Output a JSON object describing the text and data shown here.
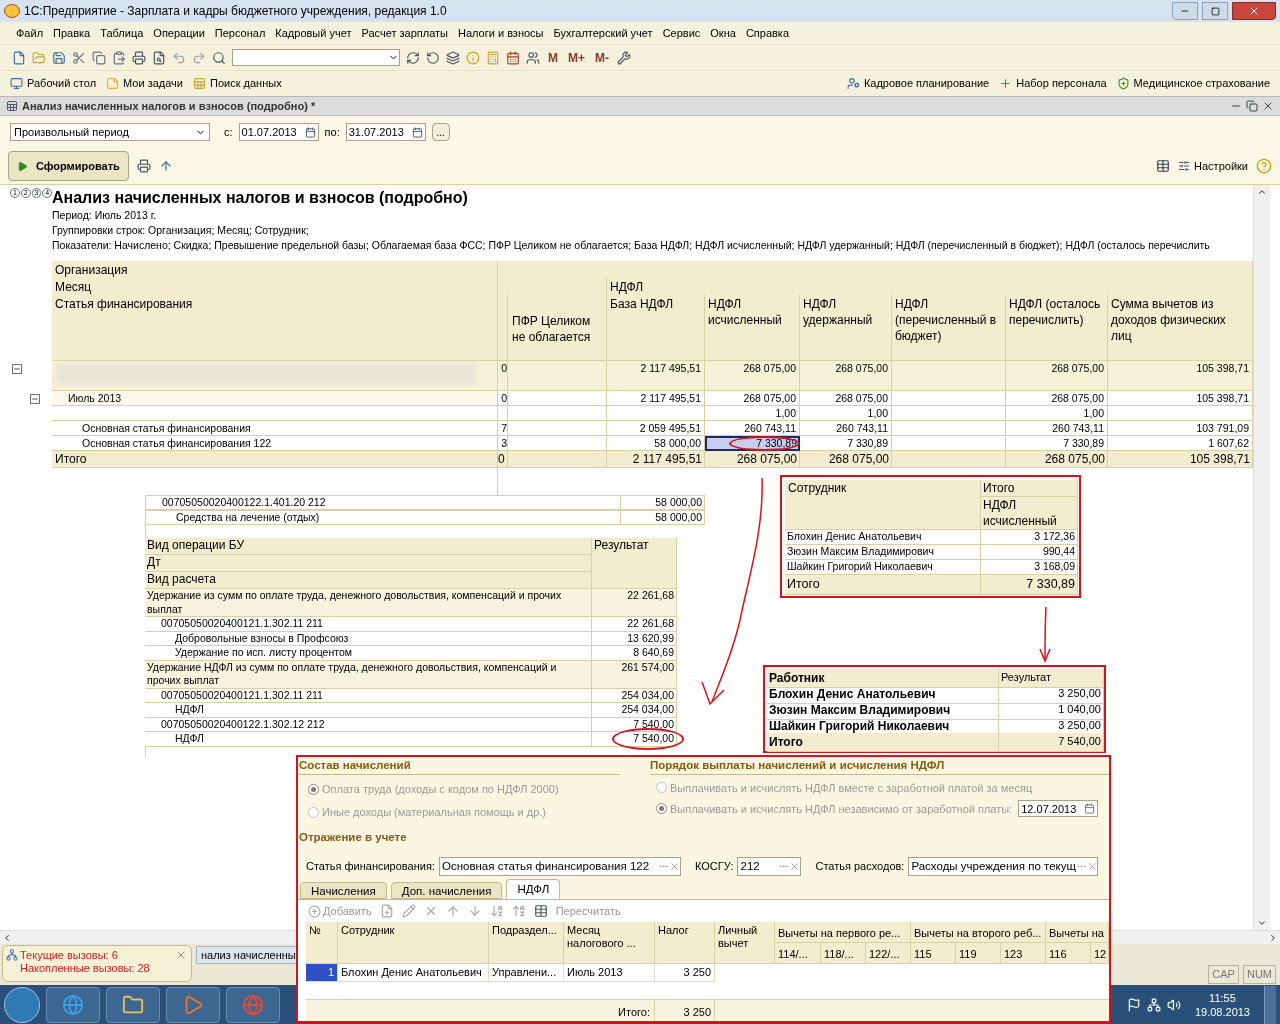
{
  "window": {
    "title": "1С:Предприятие - Зарплата и кадры бюджетного учреждения, редакция 1.0"
  },
  "menu": [
    "Файл",
    "Правка",
    "Таблица",
    "Операции",
    "Персонал",
    "Кадровый учет",
    "Расчет зарплаты",
    "Налоги и взносы",
    "Бухгалтерский учет",
    "Сервис",
    "Окна",
    "Справка"
  ],
  "memory_buttons": [
    "M",
    "M+",
    "M-"
  ],
  "panel_left": [
    "Рабочий стол",
    "Мои задачи",
    "Поиск данных"
  ],
  "panel_right": [
    "Кадровое планирование",
    "Набор персонала",
    "Медицинское страхование"
  ],
  "document": {
    "title": "Анализ начисленных налогов и взносов (подробно) *"
  },
  "period": {
    "type": "Произвольный период",
    "from_label": "с:",
    "from": "01.07.2013",
    "to_label": "по:",
    "to": "31.07.2013",
    "more": "..."
  },
  "generate_button": "Сформировать",
  "settings_button": "Настройки",
  "group_levels": [
    "1",
    "2",
    "3",
    "4"
  ],
  "report": {
    "title": "Анализ начисленных налогов и взносов (подробно)",
    "lines": [
      "Период: Июль 2013 г.",
      "Группировки строк: Организация; Месяц; Сотрудник;",
      "Показатели: Начислено; Скидка; Превышение предельной базы; Облагаемая база ФСС; ПФР Целиком не облагается; База НДФЛ; НДФЛ исчисленный; НДФЛ удержанный; НДФЛ (перечисленный в бюджет); НДФЛ (осталось перечислить"
    ],
    "row_headers": [
      "Организация",
      "Месяц",
      "Статья финансирования"
    ],
    "group_header": "НДФЛ",
    "columns": [
      {
        "label": "ПФР Целиком не облагается",
        "current": false
      },
      {
        "label": "База НДФЛ",
        "current": false
      },
      {
        "label": "НДФЛ исчисленный",
        "current": true
      },
      {
        "label": "НДФЛ удержанный",
        "current": false
      },
      {
        "label": "НДФЛ (перечисленный в бюджет)",
        "current": false
      },
      {
        "label": "НДФЛ (осталось перечислить)",
        "current": false
      },
      {
        "label": "Сумма вычетов из доходов физических лиц",
        "current": false
      }
    ],
    "rows": [
      {
        "redacted": true,
        "column_1": "0",
        "values": [
          {
            "kind": "blank"
          },
          {
            "kind": "amount",
            "text": "2 117 495,51"
          },
          {
            "kind": "amount",
            "text": "268 075,00"
          },
          {
            "kind": "amount",
            "text": "268 075,00"
          },
          {
            "kind": "blank"
          },
          {
            "kind": "amount",
            "text": "268 075,00"
          },
          {
            "kind": "amount",
            "text": "105 398,71"
          }
        ],
        "expanded": true,
        "selected": false,
        "circled": false,
        "children": [
          {
            "label": "Июль 2013",
            "column_1": "0",
            "values": [
              {
                "kind": "blank"
              },
              {
                "kind": "amount",
                "text": "2 117 495,51"
              },
              {
                "kind": "amount",
                "text": "268 075,00"
              },
              {
                "kind": "amount",
                "text": "268 075,00"
              },
              {
                "kind": "blank"
              },
              {
                "kind": "amount",
                "text": "268 075,00"
              },
              {
                "kind": "amount",
                "text": "105 398,71"
              }
            ],
            "expanded": true,
            "selected": false,
            "circled": false,
            "children": [
              {
                "values": [
                  {
                    "kind": "blank"
                  },
                  {
                    "kind": "blank"
                  },
                  {
                    "kind": "amount",
                    "text": "1,00"
                  },
                  {
                    "kind": "amount",
                    "text": "1,00"
                  },
                  {
                    "kind": "blank"
                  },
                  {
                    "kind": "amount",
                    "text": "1,00"
                  },
                  {
                    "kind": "blank"
                  }
                ],
                "selected": false,
                "circled": false
              },
              {
                "label": "Основная статья финансирования",
                "column_1": "7",
                "values": [
                  {
                    "kind": "blank"
                  },
                  {
                    "kind": "amount",
                    "text": "2 059 495,51"
                  },
                  {
                    "kind": "amount",
                    "text": "260 743,11"
                  },
                  {
                    "kind": "amount",
                    "text": "260 743,11"
                  },
                  {
                    "kind": "blank"
                  },
                  {
                    "kind": "amount",
                    "text": "260 743,11"
                  },
                  {
                    "kind": "amount",
                    "text": "103 791,09"
                  }
                ],
                "selected": false,
                "circled": false
              },
              {
                "label": "Основная статья финансирования 122",
                "column_1": "3",
                "values": [
                  {
                    "kind": "blank"
                  },
                  {
                    "kind": "amount",
                    "text": "58 000,00"
                  },
                  {
                    "kind": "amount",
                    "text": "7 330,89"
                  },
                  {
                    "kind": "amount",
                    "text": "7 330,89"
                  },
                  {
                    "kind": "blank"
                  },
                  {
                    "kind": "amount",
                    "text": "7 330,89"
                  },
                  {
                    "kind": "amount",
                    "text": "1 607,62"
                  }
                ],
                "selected": true,
                "circled": true
              }
            ]
          }
        ]
      }
    ],
    "total": {
      "label": "Итого",
      "column_1": "0",
      "values": [
        {
          "kind": "blank"
        },
        {
          "kind": "amount",
          "text": "2 117 495,51"
        },
        {
          "kind": "amount",
          "text": "268 075,00"
        },
        {
          "kind": "amount",
          "text": "268 075,00"
        },
        {
          "kind": "blank"
        },
        {
          "kind": "amount",
          "text": "268 075,00"
        },
        {
          "kind": "amount",
          "text": "105 398,71"
        }
      ]
    }
  },
  "ledger_fragment": {
    "rows": [
      {
        "label": "00705050020400122.1.401.20  212",
        "value": "58 000,00",
        "children": [
          {
            "label": "Средства на лечение (отдых)",
            "value": "58 000,00"
          }
        ]
      }
    ]
  },
  "operations_fragment": {
    "headers": [
      "Вид операции БУ",
      "Дт",
      "Вид расчета"
    ],
    "result_header": "Результат",
    "rows": [
      {
        "label": "Удержание из сумм по оплате труда, денежного довольствия, компенсаций и прочих выплат",
        "value": "22 261,68",
        "circled": false,
        "children": [
          {
            "label": "00705050020400121.1.302.11  211",
            "value": "22 261,68",
            "circled": false,
            "children": [
              {
                "label": "Добровольные  взносы в Профсоюз",
                "value": "13 620,99",
                "circled": false
              },
              {
                "label": "Удержание по исп. листу процентом",
                "value": "8 640,69",
                "circled": false
              }
            ]
          }
        ]
      },
      {
        "label": "Удержание НДФЛ из сумм по оплате труда, денежного довольствия, компенсаций и прочих выплат",
        "value": "261 574,00",
        "circled": false,
        "children": [
          {
            "label": "00705050020400121.1.302.11  211",
            "value": "254 034,00",
            "circled": false,
            "children": [
              {
                "label": "НДФЛ",
                "value": "254 034,00",
                "circled": false
              }
            ]
          },
          {
            "label": "00705050020400122.1.302.12  212",
            "value": "7 540,00",
            "circled": false,
            "children": [
              {
                "label": "НДФЛ",
                "value": "7 540,00",
                "circled": true
              }
            ]
          }
        ]
      }
    ]
  },
  "employee_fragment": {
    "columns": [
      "Сотрудник",
      "Итого",
      "НДФЛ исчисленный"
    ],
    "rows": [
      {
        "name": "Блохин Денис Анатольевич",
        "value": "3 172,36"
      },
      {
        "name": "Зюзин Максим Владимирович",
        "value": "990,44"
      },
      {
        "name": "Шайкин Григорий Николаевич",
        "value": "3 168,09"
      }
    ],
    "total": {
      "label": "Итого",
      "value": "7 330,89"
    }
  },
  "worker_fragment": {
    "columns": [
      "Работник",
      "Результат"
    ],
    "rows": [
      {
        "name": "Блохин Денис Анатольевич",
        "value": "3 250,00"
      },
      {
        "name": "Зюзин Максим Владимирович",
        "value": "1 040,00"
      },
      {
        "name": "Шайкин Григорий Николаевич",
        "value": "3 250,00"
      }
    ],
    "total": {
      "label": "Итого",
      "value": "7 540,00"
    }
  },
  "dialog": {
    "composition": {
      "title": "Состав начислений",
      "options": [
        {
          "label": "Оплата труда (доходы с кодом по НДФЛ 2000)",
          "selected": true
        },
        {
          "label": "Иные доходы (материальная помощь и др.)",
          "selected": false
        }
      ]
    },
    "payment_order": {
      "title": "Порядок выплаты начислений и исчисления НДФЛ",
      "options": [
        {
          "label": "Выплачивать и исчислять НДФЛ вместе с заработной платой за месяц",
          "selected": false
        },
        {
          "label": "Выплачивать и исчислять НДФЛ независимо от заработной платы:",
          "selected": true
        }
      ],
      "date": "12.07.2013"
    },
    "accounting": {
      "title": "Отражение в учете",
      "fields": [
        {
          "label": "Статья финансирования:",
          "value": "Основная статья финансирования 122"
        },
        {
          "label": "КОСГУ:",
          "value": "212"
        },
        {
          "label": "Статья расходов:",
          "value": "Расходы учреждения по текущ"
        }
      ]
    },
    "tabs": [
      {
        "label": "Начисления",
        "selected": false
      },
      {
        "label": "Доп. начисления",
        "selected": false
      },
      {
        "label": "НДФЛ",
        "selected": true
      }
    ],
    "toolbar": {
      "add": "Добавить",
      "recalc": "Пересчитать"
    },
    "table": {
      "columns": [
        "№",
        "Сотрудник",
        "Подраздел...",
        "Месяц налогового ...",
        "Налог",
        "Личный вычет"
      ],
      "groups": [
        {
          "label": "Вычеты на первого ре...",
          "columns": [
            "114/...",
            "118/...",
            "122/..."
          ]
        },
        {
          "label": "Вычеты на второго реб...",
          "columns": [
            "115",
            "119",
            "123"
          ]
        },
        {
          "label": "Вычеты на",
          "columns": [
            "116",
            "12"
          ]
        }
      ],
      "rows": [
        {
          "cells": [
            "1",
            "Блохин Денис Анатольевич",
            "Управлени...",
            "Июль 2013",
            "3 250"
          ],
          "selected": true
        }
      ],
      "total_label": "Итого:",
      "total": "3 250"
    }
  },
  "window_tab": "нализ начисленны",
  "notification": {
    "lines": [
      "Текущие вызовы: 6",
      "Накопленные вызовы: 28"
    ]
  },
  "status": [
    "CAP",
    "NUM"
  ],
  "clock": {
    "time": "11:55",
    "date": "19.08.2013"
  }
}
